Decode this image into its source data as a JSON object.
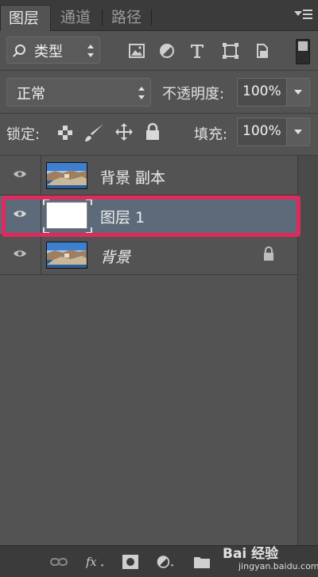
{
  "tabs": [
    {
      "label": "图层",
      "active": true
    },
    {
      "label": "通道",
      "active": false
    },
    {
      "label": "路径",
      "active": false
    }
  ],
  "filter": {
    "kind_label": "类型"
  },
  "blend": {
    "mode_label": "正常",
    "opacity_label": "不透明度:",
    "opacity_value": "100%"
  },
  "lock": {
    "label": "锁定:",
    "fill_label": "填充:",
    "fill_value": "100%"
  },
  "layers": [
    {
      "name": "背景 副本",
      "visible": true,
      "thumbnail": "landscape-photo",
      "selected": false,
      "locked": false
    },
    {
      "name": "图层 1",
      "visible": true,
      "thumbnail": "white",
      "selected": true,
      "locked": false
    },
    {
      "name": "背景",
      "visible": true,
      "thumbnail": "landscape-photo",
      "selected": false,
      "locked": true,
      "italic": true
    }
  ],
  "icons": {
    "filter_pixel": "image-filter-icon",
    "filter_adjust": "adjustment-filter-icon",
    "filter_type": "type-filter-icon",
    "filter_shape": "shape-filter-icon",
    "filter_smart": "smart-object-filter-icon"
  },
  "highlight_color": "#e02a5e",
  "watermark": {
    "text": "Bai 经验",
    "url": "jingyan.baidu.com"
  }
}
